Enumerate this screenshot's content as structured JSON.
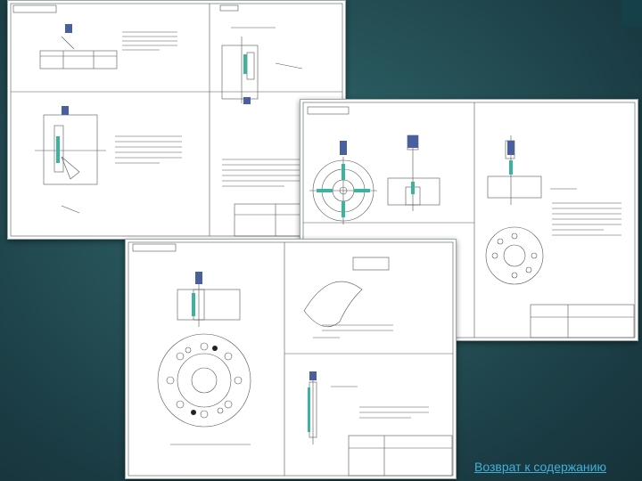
{
  "slide": {
    "return_link": "Возврат к содержанию"
  },
  "colors": {
    "background": "#244f55",
    "link": "#3fb1d9",
    "drawing_line": "#444444",
    "coolant_green": "#3cb39c",
    "tool_blue": "#4a5fa0"
  }
}
